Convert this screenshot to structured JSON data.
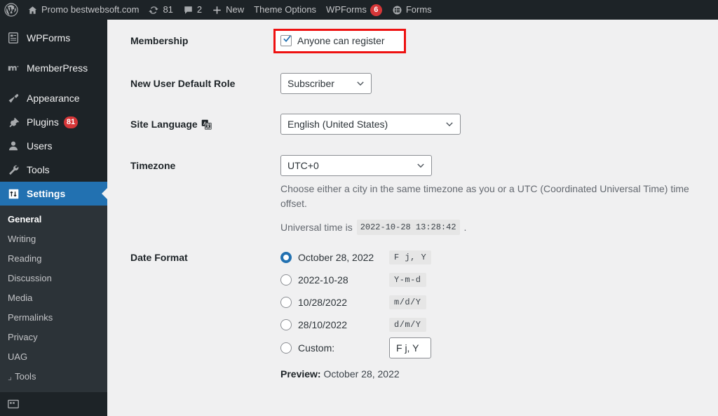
{
  "adminbar": {
    "logo_icon": "wordpress-logo-icon",
    "items": [
      {
        "icon": "home-icon",
        "label": "Promo bestwebsoft.com",
        "badge": null
      },
      {
        "icon": "updates-icon",
        "label": "81",
        "badge": null
      },
      {
        "icon": "comments-icon",
        "label": "2",
        "badge": null
      },
      {
        "icon": "plus-icon",
        "label": "New",
        "badge": null
      },
      {
        "icon": null,
        "label": "Theme Options",
        "badge": null
      },
      {
        "icon": null,
        "label": "WPForms",
        "badge": "6"
      },
      {
        "icon": "forms-icon",
        "label": "Forms",
        "badge": null
      }
    ]
  },
  "sidebar": {
    "top_items": [
      {
        "icon": "wpforms-icon",
        "label": "WPForms"
      },
      {
        "icon": "memberpress-icon",
        "label": "MemberPress"
      },
      {
        "icon": "appearance-brush-icon",
        "label": "Appearance"
      },
      {
        "icon": "plugins-plug-icon",
        "label": "Plugins",
        "badge": "81"
      },
      {
        "icon": "users-person-icon",
        "label": "Users"
      },
      {
        "icon": "tools-wrench-icon",
        "label": "Tools"
      },
      {
        "icon": "settings-sliders-icon",
        "label": "Settings",
        "current": true
      }
    ],
    "submenu": [
      {
        "label": "General",
        "current": true
      },
      {
        "label": "Writing",
        "current": false
      },
      {
        "label": "Reading",
        "current": false
      },
      {
        "label": "Discussion",
        "current": false
      },
      {
        "label": "Media",
        "current": false
      },
      {
        "label": "Permalinks",
        "current": false
      },
      {
        "label": "Privacy",
        "current": false
      },
      {
        "label": "UAG",
        "current": false
      },
      {
        "label": "Tools",
        "current": false,
        "nested": true
      }
    ],
    "bottom_cut_item": {
      "icon": "custom-fields-icon",
      "label": ""
    }
  },
  "settings": {
    "membership": {
      "label": "Membership",
      "checkbox_label": "Anyone can register",
      "checked": true,
      "highlight_color": "#ee1111"
    },
    "default_role": {
      "label": "New User Default Role",
      "value": "Subscriber"
    },
    "site_language": {
      "label": "Site Language",
      "icon": "translation-icon",
      "value": "English (United States)"
    },
    "timezone": {
      "label": "Timezone",
      "value": "UTC+0",
      "description": "Choose either a city in the same timezone as you or a UTC (Coordinated Universal Time) time offset.",
      "universal_time_prefix": "Universal time is",
      "universal_time_value": "2022-10-28 13:28:42",
      "universal_time_suffix": "."
    },
    "date_format": {
      "label": "Date Format",
      "options": [
        {
          "display": "October 28, 2022",
          "code": "F j, Y",
          "selected": true
        },
        {
          "display": "2022-10-28",
          "code": "Y-m-d",
          "selected": false
        },
        {
          "display": "10/28/2022",
          "code": "m/d/Y",
          "selected": false
        },
        {
          "display": "28/10/2022",
          "code": "d/m/Y",
          "selected": false
        }
      ],
      "custom_label": "Custom:",
      "custom_value": "F j, Y",
      "custom_selected": false,
      "preview_label": "Preview:",
      "preview_value": "October 28, 2022"
    }
  }
}
